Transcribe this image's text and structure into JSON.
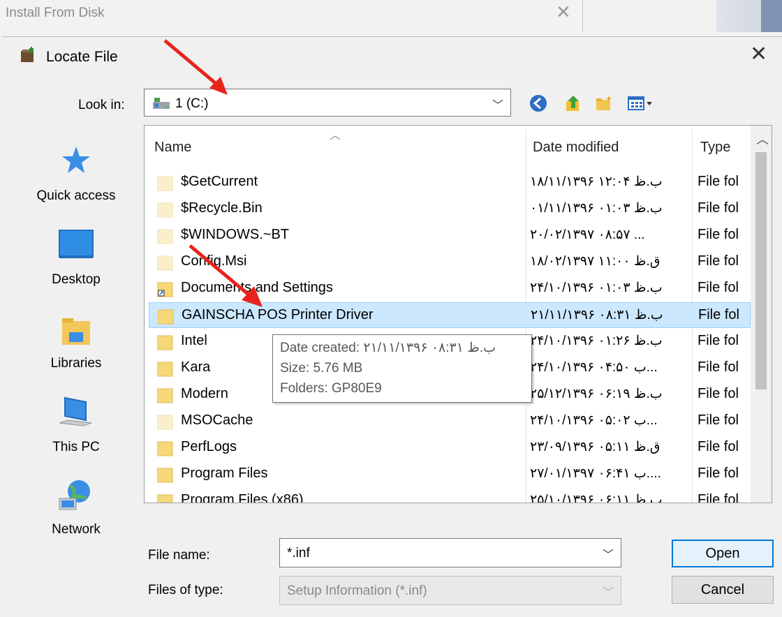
{
  "background_window": {
    "title": "Install From Disk",
    "close_glyph": "✕"
  },
  "dialog": {
    "title": "Locate File",
    "close_glyph": "✕",
    "icon": "folder-open-icon"
  },
  "lookin": {
    "label": "Look in:",
    "value": "1 (C:)",
    "dropdown_glyph": "﹀"
  },
  "toolbar": {
    "icons": [
      "back-icon",
      "up-folder-icon",
      "new-folder-icon",
      "view-menu-icon"
    ]
  },
  "places": [
    {
      "label": "Quick access",
      "icon": "star-icon"
    },
    {
      "label": "Desktop",
      "icon": "desktop-icon"
    },
    {
      "label": "Libraries",
      "icon": "libraries-icon"
    },
    {
      "label": "This PC",
      "icon": "computer-icon"
    },
    {
      "label": "Network",
      "icon": "network-icon"
    }
  ],
  "columns": {
    "name": "Name",
    "date": "Date modified",
    "type": "Type"
  },
  "files": [
    {
      "name": "$GetCurrent",
      "date": "۱۸/۱۱/۱۳۹۶ ب.ظ ۱۲:۰۴",
      "type": "File fol"
    },
    {
      "name": "$Recycle.Bin",
      "date": "۰۱/۱۱/۱۳۹۶ ب.ظ ۰۱:۰۳",
      "type": "File fol"
    },
    {
      "name": "$WINDOWS.~BT",
      "date": "۲۰/۰۲/۱۳۹۷ ۰۸:۵۷ ...",
      "type": "File fol"
    },
    {
      "name": "Config.Msi",
      "date": "۱۸/۰۲/۱۳۹۷ ق.ظ ۱۱:۰۰",
      "type": "File fol"
    },
    {
      "name": "Documents and Settings",
      "date": "۲۴/۱۰/۱۳۹۶ ب.ظ ۰۱:۰۳",
      "type": "File fol"
    },
    {
      "name": "GAINSCHA POS Printer Driver",
      "date": "۲۱/۱۱/۱۳۹۶ ب.ظ ۰۸:۳۱",
      "type": "File fol"
    },
    {
      "name": "Intel",
      "date": "۲۴/۱۰/۱۳۹۶ ب.ظ ۰۱:۲۶",
      "type": "File fol"
    },
    {
      "name": "Kara",
      "date": "۲۴/۱۰/۱۳۹۶ ب ۰۴:۵۰...",
      "type": "File fol"
    },
    {
      "name": "Modern",
      "date": "۲۵/۱۲/۱۳۹۶ ب.ظ ۰۶:۱۹",
      "type": "File fol"
    },
    {
      "name": "MSOCache",
      "date": "۲۴/۱۰/۱۳۹۶ ب ۰۵:۰۲...",
      "type": "File fol"
    },
    {
      "name": "PerfLogs",
      "date": "۲۳/۰۹/۱۳۹۶ ق.ظ ۰۵:۱۱",
      "type": "File fol"
    },
    {
      "name": "Program Files",
      "date": "۲۷/۰۱/۱۳۹۷ ب ۰۶:۴۱....",
      "type": "File fol"
    },
    {
      "name": "Program Files (x86)",
      "date": "۲۵/۱۰/۱۳۹۶ ب.ظ ۰۶:۱۱",
      "type": "File fol"
    }
  ],
  "tooltip": {
    "date_created": "Date created: ۲۱/۱۱/۱۳۹۶ ب.ظ ۰۸:۳۱",
    "size": "Size: 5.76 MB",
    "folders": "Folders: GP80E9"
  },
  "filename": {
    "label": "File name:",
    "value": "*.inf"
  },
  "filetype": {
    "label": "Files of type:",
    "value": "Setup Information (*.inf)"
  },
  "buttons": {
    "open": "Open",
    "cancel": "Cancel"
  },
  "colors": {
    "selection": "#cce8ff",
    "accent": "#0078d7",
    "annotation_arrow": "#e8231b",
    "folder": "#f6d77a"
  }
}
